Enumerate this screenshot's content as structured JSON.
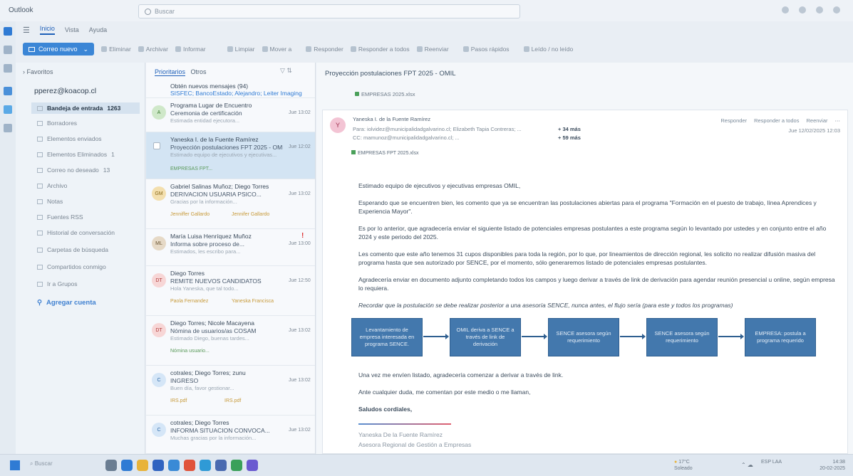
{
  "app": {
    "title": "Outlook"
  },
  "search": {
    "placeholder": "Buscar"
  },
  "ribbon_tabs": [
    "Inicio",
    "Vista",
    "Ayuda"
  ],
  "ribbon": {
    "new_mail": "Correo nuevo",
    "actions": [
      "Eliminar",
      "Archivar",
      "Informar",
      "Limpiar",
      "Mover a",
      "Responder",
      "Responder a todos",
      "Reenviar",
      "Pasos rápidos",
      "Leído / no leído"
    ]
  },
  "folders": {
    "header": "Favoritos",
    "account": "pperez@koacop.cl",
    "items": [
      {
        "label": "Bandeja de entrada",
        "count": "1263",
        "selected": true
      },
      {
        "label": "Borradores",
        "count": ""
      },
      {
        "label": "Elementos enviados",
        "count": ""
      },
      {
        "label": "Elementos Eliminados",
        "count": "1"
      },
      {
        "label": "Correo no deseado",
        "count": "13"
      },
      {
        "label": "Archivo",
        "count": ""
      },
      {
        "label": "Notas",
        "count": ""
      },
      {
        "label": "Fuentes RSS",
        "count": ""
      },
      {
        "label": "Historial de conversación",
        "count": ""
      },
      {
        "label": "Carpetas de búsqueda",
        "count": ""
      },
      {
        "label": "Compartidos conmigo",
        "count": ""
      },
      {
        "label": "Ir a Grupos",
        "count": ""
      }
    ],
    "add_account": "Agregar cuenta"
  },
  "message_list": {
    "header": "Prioritarios",
    "header_other": "Otros",
    "messages": [
      {
        "avatar": "",
        "sender": "Obtén nuevos mensajes (94)",
        "subject": "SISFEC; BancoEstado; Alejandro; Leiter Imaging",
        "date": "",
        "preview": "",
        "tag": "",
        "tag2": "",
        "flag": ""
      },
      {
        "avatar": "A",
        "sender": "Programa Lugar de Encuentro",
        "subject": "Ceremonia de certificación",
        "date": "Jue 13:02",
        "preview": "Estimada entidad ejecutora...",
        "tag": "",
        "tag2": "",
        "flag": ""
      },
      {
        "avatar": "",
        "sender": "Yaneska I. de la Fuente Ramírez",
        "subject": "Proyección postulaciones FPT 2025 - OMIL",
        "date": "Jue 12:02",
        "preview": "Estimado equipo de ejecutivos y ejecutivas...",
        "tag": "EMPRESAS FPT...",
        "tag2": "",
        "flag": ""
      },
      {
        "avatar": "GM",
        "sender": "Gabriel Salinas Muñoz; Diego Torres",
        "subject": "DERIVACION USUARIA PSICO...",
        "date": "Jue 13:02",
        "preview": "Gracias por la información...",
        "tag": "Jenniffer Gallardo",
        "tag2": "Jennifer Gallardo",
        "flag": ""
      },
      {
        "avatar": "ML",
        "sender": "María Luisa Henríquez Muñoz",
        "subject": "Informa sobre proceso de...",
        "date": "Jue 13:00",
        "preview": "Estimados, les escribo para...",
        "tag": "",
        "tag2": "",
        "flag": "!"
      },
      {
        "avatar": "DT",
        "sender": "Diego Torres",
        "subject": "REMITE NUEVOS CANDIDATOS",
        "date": "Jue 12:50",
        "preview": "Hola Yaneska, que tal todo...",
        "tag": "Paola Fernandez",
        "tag2": "Yaneska Francisca",
        "flag": ""
      },
      {
        "avatar": "DT",
        "sender": "Diego Torres; Nicole Macayena",
        "subject": "Nómina de usuarios/as COSAM",
        "date": "Jue 13:02",
        "preview": "Estimado Diego, buenas tardes...",
        "tag": "Nómina usuario...",
        "tag2": "",
        "flag": ""
      },
      {
        "avatar": "C",
        "sender": "cotrales; Diego Torres; zunu",
        "subject": "INGRESO",
        "date": "Jue 13:02",
        "preview": "Buen día, favor gestionar...",
        "tag": "IRS.pdf",
        "tag2": "IRS.pdf",
        "flag": ""
      },
      {
        "avatar": "C",
        "sender": "cotrales; Diego Torres",
        "subject": "INFORMA SITUACION CONVOCA...",
        "date": "Jue 13:02",
        "preview": "Muchas gracias por la información...",
        "tag": "",
        "tag2": "",
        "flag": ""
      }
    ]
  },
  "reading": {
    "title": "Proyección postulaciones FPT 2025 - OMIL",
    "category": "EMPRESAS 2025.xlsx",
    "sender": "Yaneska I. de la Fuente Ramírez",
    "sender_initial": "Y",
    "to_line": "Para: iolvidez@municipalidadgalvarino.cl; Elizabeth Tapia Contreras; ...",
    "to_more": "+ 34 más",
    "cc_line": "CC: mamunoz@municipalidadgalvarino.cl; ...",
    "cc_more": "+ 59 más",
    "date": "Jue 12/02/2025 12:03",
    "actions": [
      "Responder",
      "Responder a todos",
      "Reenviar"
    ],
    "attachment": "EMPRESAS FPT 2025.xlsx",
    "body": [
      "Estimado equipo de ejecutivos y ejecutivas empresas OMIL,",
      "Esperando que se encuentren bien, les comento que ya se encuentran las postulaciones abiertas para el programa \"Formación en el puesto de trabajo, línea Aprendices y Experiencia Mayor\".",
      "Es por lo anterior, que agradecería enviar el siguiente listado de potenciales empresas postulantes a este programa según lo levantado por ustedes y en conjunto entre el año 2024 y este periodo del 2025.",
      "Les comento que este año tenemos 31 cupos disponibles para toda la región, por lo que, por lineamientos de dirección regional, les solicito no realizar difusión masiva del programa hasta que sea autorizado por SENCE, por el momento, sólo generaremos listado de potenciales empresas postulantes.",
      "Agradecería enviar en documento adjunto completando todos los campos y luego derivar a través de link de derivación para agendar reunión presencial u online, según empresa lo requiera.",
      "Recordar que la postulación se debe realizar posterior a una asesoría SENCE, nunca antes, el flujo sería (para este y todos los programas)",
      "Una vez me envíen listado, agradecería comenzar a derivar a través de link.",
      "Ante cualquier duda, me comentan por este medio o me llaman,",
      "Saludos cordiales,"
    ],
    "flow": [
      "Levantamiento de empresa interesada en programa SENCE.",
      "OMIL deriva a SENCE a través de link de derivación",
      "SENCE asesora según requerimiento",
      "SENCE asesora según requerimiento",
      "EMPRESA: postula a programa requerido"
    ],
    "signature": [
      "Yaneska De la Fuente Ramírez",
      "Asesora Regional de Gestión a Empresas"
    ]
  },
  "taskbar": {
    "search": "Buscar",
    "weather_temp": "17°C",
    "weather_desc": "Soleado",
    "lang": "ESP LAA",
    "time": "14:38",
    "date": "20-02-2025"
  },
  "colors": {
    "accent": "#1d5fb8",
    "flow_box": "#4378ad",
    "flag": "#dd3333"
  }
}
